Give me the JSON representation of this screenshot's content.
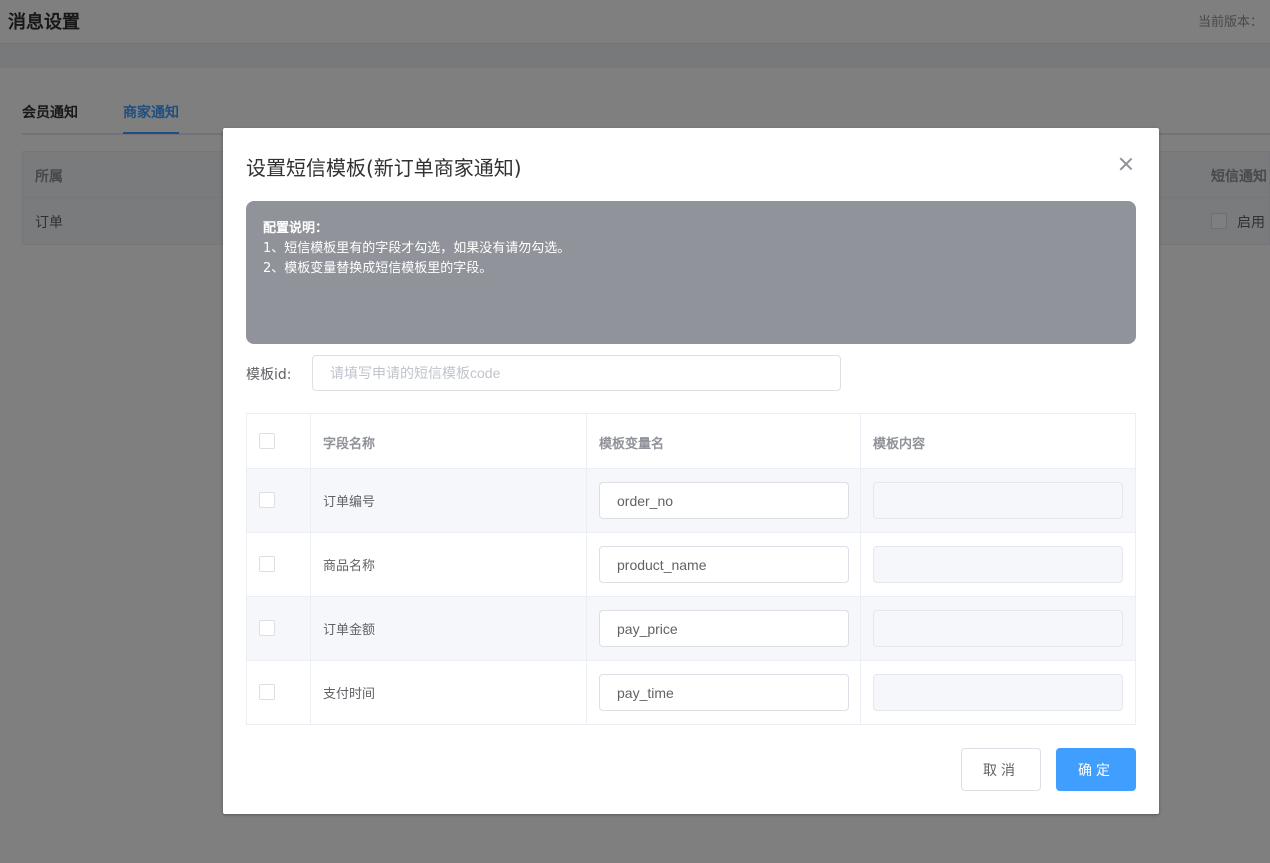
{
  "page": {
    "title": "消息设置",
    "version_label": "当前版本："
  },
  "tabs": [
    {
      "label": "会员通知",
      "active": false
    },
    {
      "label": "商家通知",
      "active": true
    }
  ],
  "bg_table": {
    "headers": [
      "所属",
      "短信通知"
    ],
    "row": {
      "category": "订单",
      "sms_toggle_label": "启用"
    }
  },
  "dialog": {
    "title": "设置短信模板(新订单商家通知)",
    "notice": {
      "title": "配置说明：",
      "lines": [
        "1、短信模板里有的字段才勾选，如果没有请勿勾选。",
        "2、模板变量替换成短信模板里的字段。"
      ]
    },
    "template_id": {
      "label": "模板id:",
      "value": "",
      "placeholder": "请填写申请的短信模板code"
    },
    "table": {
      "headers": [
        "字段名称",
        "模板变量名",
        "模板内容"
      ],
      "rows": [
        {
          "field": "订单编号",
          "variable": "order_no",
          "content": ""
        },
        {
          "field": "商品名称",
          "variable": "product_name",
          "content": ""
        },
        {
          "field": "订单金额",
          "variable": "pay_price",
          "content": ""
        },
        {
          "field": "支付时间",
          "variable": "pay_time",
          "content": ""
        }
      ]
    },
    "cancel_label": "取消",
    "confirm_label": "确定"
  },
  "colors": {
    "primary": "#409eff",
    "notice_bg": "#909399",
    "overlay": "rgba(0,0,0,0.5)"
  }
}
